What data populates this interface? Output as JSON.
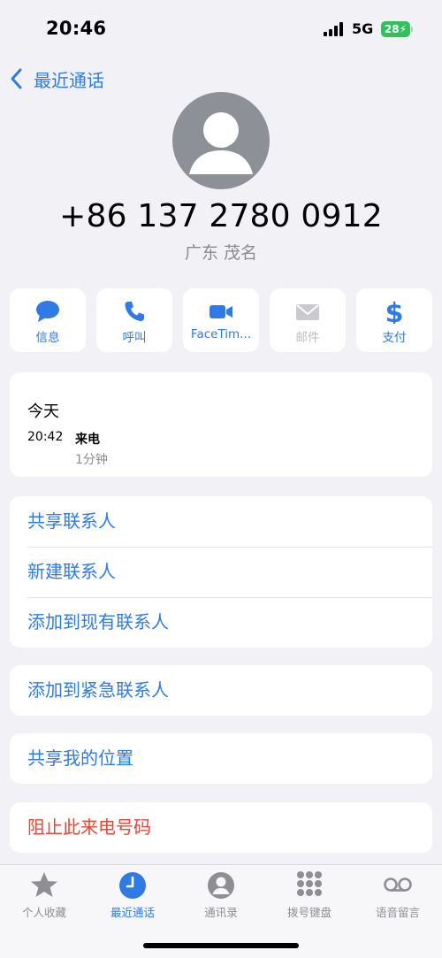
{
  "status_bar": {
    "time": "20:46",
    "network": "5G",
    "battery": "28"
  },
  "nav": {
    "back_label": "最近通话"
  },
  "contact": {
    "phone": "+86 137 2780 0912",
    "location": "广东 茂名"
  },
  "actions": [
    {
      "label": "信息",
      "icon": "message-icon",
      "enabled": true
    },
    {
      "label": "呼叫",
      "icon": "phone-icon",
      "enabled": true
    },
    {
      "label": "FaceTim...",
      "icon": "video-icon",
      "enabled": true
    },
    {
      "label": "邮件",
      "icon": "mail-icon",
      "enabled": false
    },
    {
      "label": "支付",
      "icon": "dollar-icon",
      "enabled": true
    }
  ],
  "recent": {
    "title": "今天",
    "time": "20:42",
    "type": "来电",
    "duration": "1分钟"
  },
  "contact_options": [
    "共享联系人",
    "新建联系人",
    "添加到现有联系人"
  ],
  "emergency": {
    "label": "添加到紧急联系人"
  },
  "location_share": {
    "label": "共享我的位置"
  },
  "block": {
    "label": "阻止此来电号码"
  },
  "tabs": [
    {
      "label": "个人收藏",
      "icon": "star-icon",
      "active": false
    },
    {
      "label": "最近通话",
      "icon": "clock-icon",
      "active": true
    },
    {
      "label": "通讯录",
      "icon": "person-circle-icon",
      "active": false
    },
    {
      "label": "拨号键盘",
      "icon": "keypad-icon",
      "active": false
    },
    {
      "label": "语音留言",
      "icon": "voicemail-icon",
      "active": false
    }
  ],
  "colors": {
    "accent": "#2f7ae5",
    "danger": "#e8443a",
    "background": "#f2f2f6",
    "battery": "#30c25a"
  }
}
